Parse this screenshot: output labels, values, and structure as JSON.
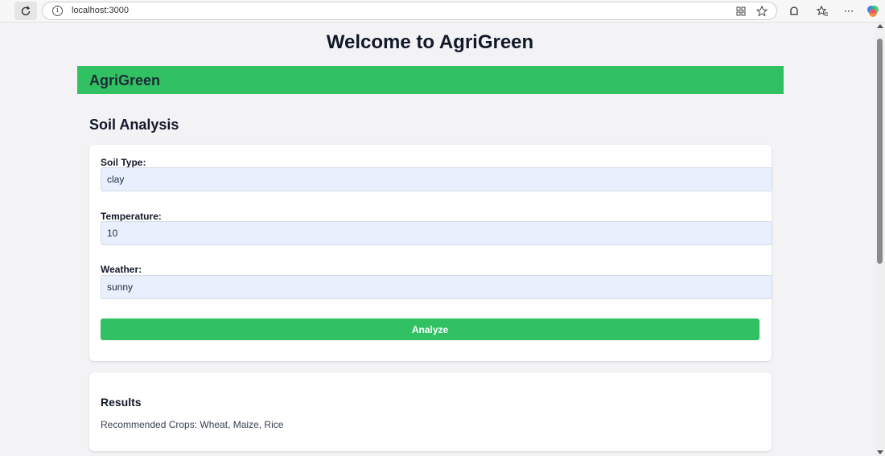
{
  "browser": {
    "url": "localhost:3000"
  },
  "page": {
    "title": "Welcome to AgriGreen"
  },
  "header": {
    "brand": "AgriGreen"
  },
  "soil_analysis": {
    "title": "Soil Analysis",
    "fields": [
      {
        "label": "Soil Type:",
        "value": "clay"
      },
      {
        "label": "Temperature:",
        "value": "10"
      },
      {
        "label": "Weather:",
        "value": "sunny"
      }
    ],
    "submit_label": "Analyze"
  },
  "results": {
    "title": "Results",
    "text": "Recommended Crops: Wheat, Maize, Rice"
  },
  "colors": {
    "accent": "#31c162",
    "input_bg": "#e8f0fe",
    "page_bg": "#f3f3f6"
  }
}
